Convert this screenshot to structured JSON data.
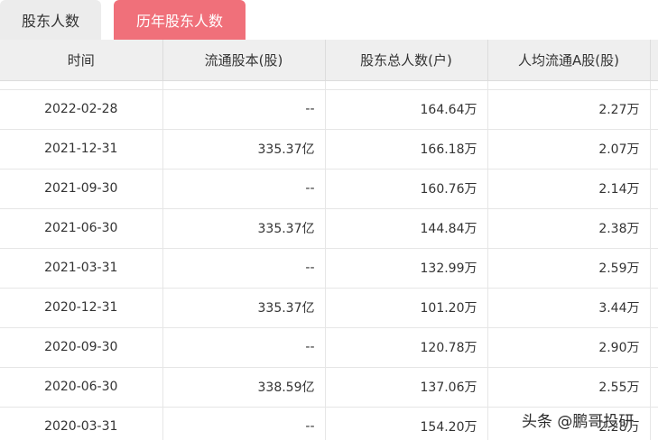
{
  "tabs": [
    {
      "label": "股东人数",
      "active": false
    },
    {
      "label": "历年股东人数",
      "active": true
    }
  ],
  "colors": {
    "accent": "#f0707a",
    "header_bg": "#efefef",
    "tab_inactive_bg": "#ececec"
  },
  "table": {
    "headers": [
      "时间",
      "流通股本(股)",
      "股东总人数(户)",
      "人均流通A股(股)"
    ],
    "rows": [
      [
        "2022-02-28",
        "--",
        "164.64万",
        "2.27万"
      ],
      [
        "2021-12-31",
        "335.37亿",
        "166.18万",
        "2.07万"
      ],
      [
        "2021-09-30",
        "--",
        "160.76万",
        "2.14万"
      ],
      [
        "2021-06-30",
        "335.37亿",
        "144.84万",
        "2.38万"
      ],
      [
        "2021-03-31",
        "--",
        "132.99万",
        "2.59万"
      ],
      [
        "2020-12-31",
        "335.37亿",
        "101.20万",
        "3.44万"
      ],
      [
        "2020-09-30",
        "--",
        "120.78万",
        "2.90万"
      ],
      [
        "2020-06-30",
        "338.59亿",
        "137.06万",
        "2.55万"
      ],
      [
        "2020-03-31",
        "--",
        "154.20万",
        "2.28万"
      ]
    ]
  },
  "watermark": "头条 @鹏哥投研"
}
